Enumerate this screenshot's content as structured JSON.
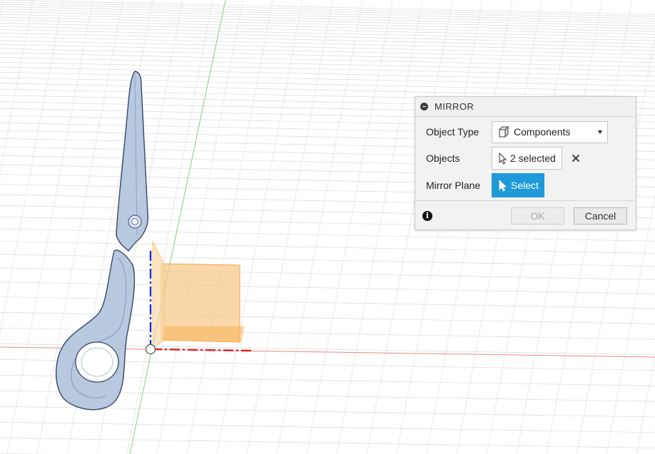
{
  "viewport": {
    "description_icons": [
      "scissors-model",
      "origin-point"
    ],
    "axis_colors": {
      "x": "#e21b1b",
      "y": "#1aa82a",
      "z": "#1a2fd0"
    },
    "model_color": "#b8c9e0",
    "plane_color": "#f6b555"
  },
  "mirror_dialog": {
    "title": "MIRROR",
    "object_type_label": "Object Type",
    "object_type_value": "Components",
    "objects_label": "Objects",
    "objects_value": "2 selected",
    "mirror_plane_label": "Mirror Plane",
    "mirror_plane_value": "Select",
    "ok_label": "OK",
    "cancel_label": "Cancel",
    "accent_color": "#1e9ad6"
  }
}
